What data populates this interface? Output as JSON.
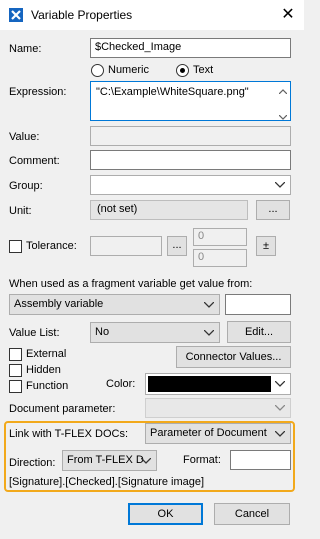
{
  "window": {
    "title": "Variable Properties"
  },
  "name": {
    "label": "Name:",
    "value": "$Checked_Image"
  },
  "type": {
    "numeric_label": "Numeric",
    "text_label": "Text",
    "selected": "Text"
  },
  "expression": {
    "label": "Expression:",
    "value": "\"C:\\Example\\WhiteSquare.png\""
  },
  "value": {
    "label": "Value:",
    "value": ""
  },
  "comment": {
    "label": "Comment:",
    "value": ""
  },
  "group": {
    "label": "Group:",
    "value": ""
  },
  "unit": {
    "label": "Unit:",
    "value": "(not set)",
    "button_label": "..."
  },
  "tolerance": {
    "label": "Tolerance:",
    "checked": false,
    "value": "",
    "button_label": "...",
    "upper": "0",
    "lower": "0",
    "pm_label": "±"
  },
  "fragment": {
    "label": "When used as a fragment variable get value from:",
    "source": "Assembly variable",
    "value": ""
  },
  "value_list": {
    "label": "Value List:",
    "value": "No",
    "edit_label": "Edit..."
  },
  "options": {
    "external_label": "External",
    "external_checked": false,
    "hidden_label": "Hidden",
    "hidden_checked": false,
    "function_label": "Function",
    "function_checked": false
  },
  "connector_values_label": "Connector Values...",
  "color": {
    "label": "Color:",
    "value": "#000000"
  },
  "document_parameter": {
    "label": "Document parameter:",
    "value": ""
  },
  "tflex_docs": {
    "link_label": "Link with T-FLEX DOCs:",
    "link_value": "Parameter of Document",
    "direction_label": "Direction:",
    "direction_value": "From T-FLEX D",
    "format_label": "Format:",
    "format_value": "",
    "path": "[Signature].[Checked].[Signature image]"
  },
  "buttons": {
    "ok_label": "OK",
    "cancel_label": "Cancel"
  },
  "colors": {
    "highlight_border": "#f2a91b",
    "focus_border": "#0078d7",
    "app_icon": "#1565c0"
  }
}
